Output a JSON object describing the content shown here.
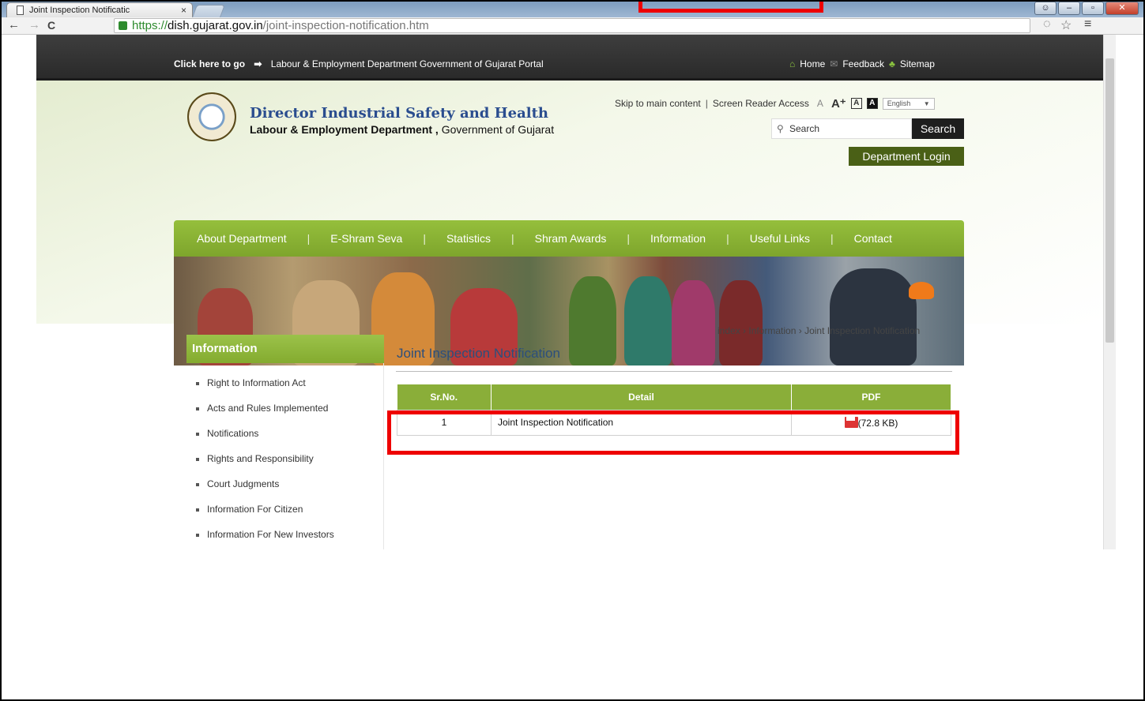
{
  "browser": {
    "tab_title": "Joint Inspection Notificatic",
    "url_scheme": "https://",
    "url_host": "dish.gujarat.gov.in",
    "url_path": "/joint-inspection-notification.htm"
  },
  "topbar": {
    "goto_label": "Click here to go",
    "portal_link": "Labour & Employment Department Government of Gujarat Portal",
    "home": "Home",
    "feedback": "Feedback",
    "sitemap": "Sitemap"
  },
  "header": {
    "title": "Director Industrial Safety and Health",
    "subtitle_bold": "Labour & Employment Department ,",
    "subtitle_rest": " Government of Gujarat",
    "skip": "Skip to main content",
    "screen_reader": "Screen Reader Access",
    "font_small": "A",
    "font_large": "A⁺",
    "font_box1": "A",
    "font_box2": "A",
    "language": "English",
    "search_placeholder": "Search",
    "search_button": "Search",
    "login": "Department Login"
  },
  "menu": [
    "About Department",
    "E-Shram Seva",
    "Statistics",
    "Shram Awards",
    "Information",
    "Useful Links",
    "Contact"
  ],
  "breadcrumb": {
    "items": [
      "index",
      "Information",
      "Joint Inspection Notification"
    ],
    "separator": "›"
  },
  "sidebar": {
    "heading": "Information",
    "items": [
      "Right to Information Act",
      "Acts and Rules Implemented",
      "Notifications",
      "Rights and Responsibility",
      "Court Judgments",
      "Information For Citizen",
      "Information For New Investors"
    ]
  },
  "content": {
    "title": "Joint Inspection Notification",
    "columns": [
      "Sr.No.",
      "Detail",
      "PDF"
    ],
    "rows": [
      {
        "sr": "1",
        "detail": "Joint Inspection Notification",
        "size": "(72.8 KB)"
      }
    ]
  },
  "colors": {
    "accent_green": "#8aae39",
    "highlight_red": "#e00000",
    "title_blue": "#2a4d8f"
  }
}
